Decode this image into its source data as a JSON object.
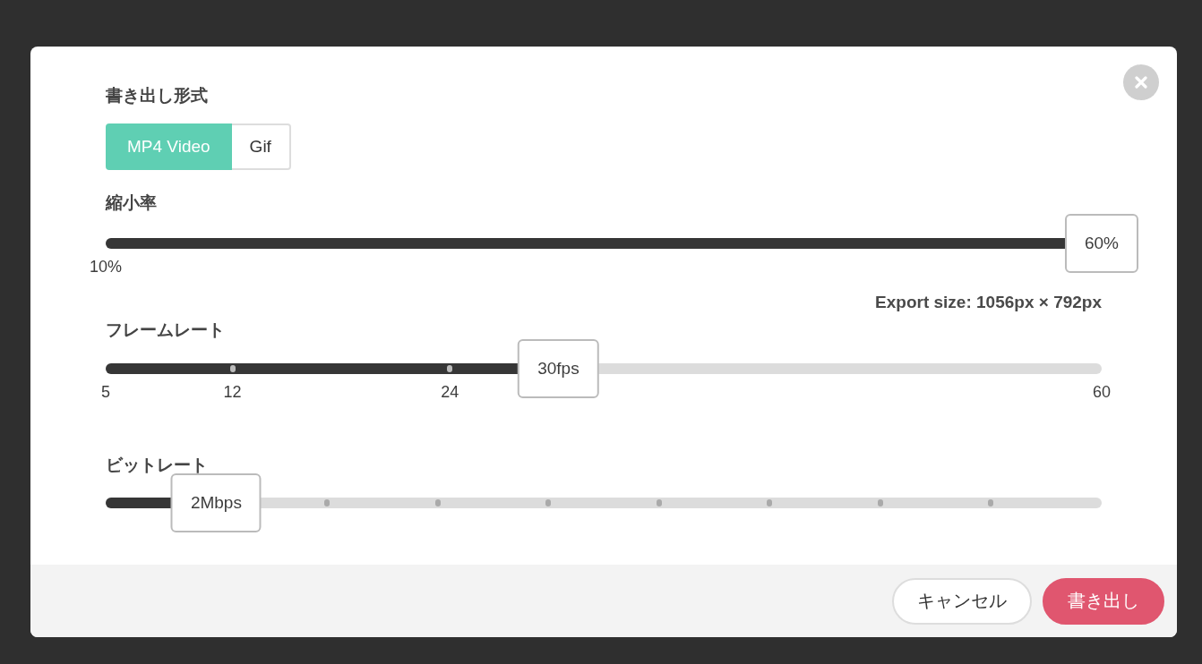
{
  "format": {
    "label": "書き出し形式",
    "options": [
      {
        "label": "MP4 Video",
        "selected": true
      },
      {
        "label": "Gif",
        "selected": false
      }
    ]
  },
  "scale": {
    "label": "縮小率",
    "level": 1,
    "value": "60%",
    "ticks": [
      "10%"
    ]
  },
  "export_size": "Export size: 1056px × 792px",
  "frame_rate": {
    "label": "フレームレート",
    "level": 0.4545,
    "value": "30fps",
    "ticks": [
      "5",
      "12",
      "24",
      "60"
    ]
  },
  "bit_rate": {
    "label": "ビットレート",
    "level": 0.111,
    "value": "2Mbps"
  },
  "buttons": [
    {
      "label": "キャンセル",
      "kind": "secondary"
    },
    {
      "label": "書き出し",
      "kind": "primary"
    }
  ]
}
